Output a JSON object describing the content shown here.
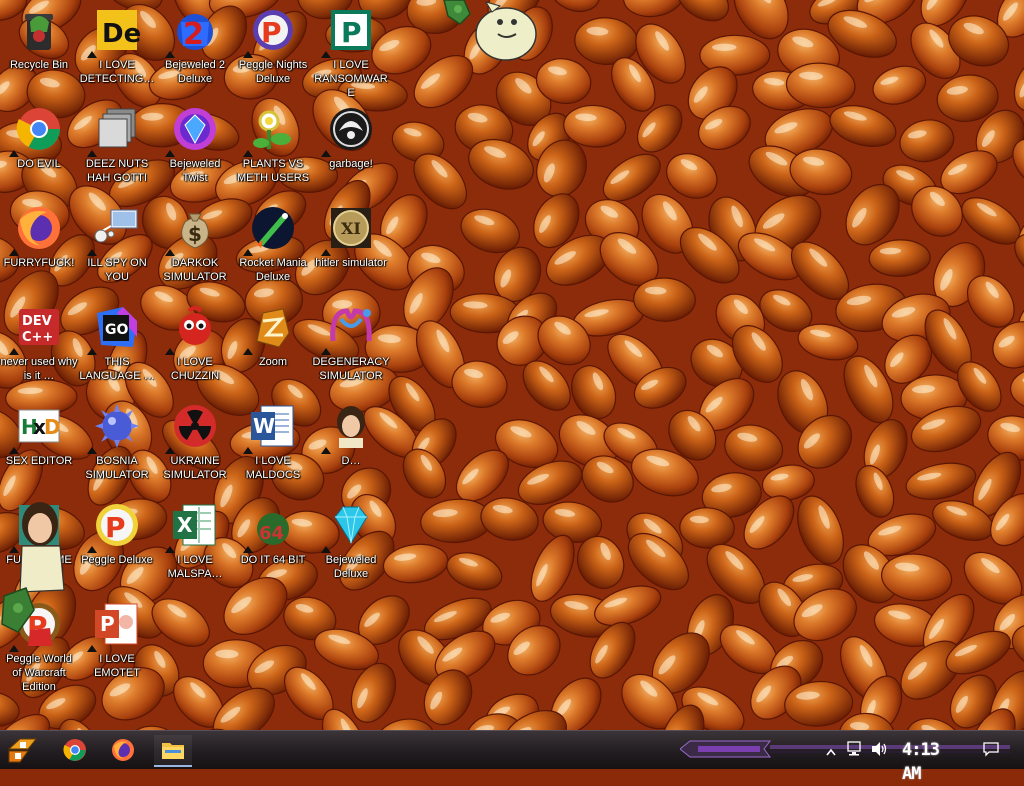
{
  "desktop": {
    "icons": [
      {
        "label": "Recycle Bin",
        "icon": "recycle-bin-icon"
      },
      {
        "label": "I LOVE DETECTING…",
        "icon": "detect-it-easy-icon"
      },
      {
        "label": "Bejeweled 2 Deluxe",
        "icon": "bejeweled-2-icon"
      },
      {
        "label": "Peggle Nights Deluxe",
        "icon": "peggle-nights-icon"
      },
      {
        "label": "I LOVE RANSOMWARE",
        "icon": "publisher-icon"
      },
      {
        "label": "DO EVIL",
        "icon": "chrome-icon"
      },
      {
        "label": "DEEZ NUTS HAH GOTTI",
        "icon": "stacked-windows-icon"
      },
      {
        "label": "Bejeweled Twist",
        "icon": "bejeweled-twist-icon"
      },
      {
        "label": "PLANTS VS METH USERS",
        "icon": "plants-vs-zombies-icon"
      },
      {
        "label": "garbage!",
        "icon": "garbage-emblem-icon"
      },
      {
        "label": "FURRYFUCK!",
        "icon": "firefox-icon"
      },
      {
        "label": "ILL SPY ON YOU",
        "icon": "network-spy-icon"
      },
      {
        "label": "DARKOK SIMULATOR",
        "icon": "money-bag-icon"
      },
      {
        "label": "Rocket Mania Deluxe",
        "icon": "rocket-mania-icon"
      },
      {
        "label": "hitler simulator",
        "icon": "medallion-icon"
      },
      {
        "label": "never used why is it …",
        "icon": "dev-cpp-icon"
      },
      {
        "label": "THIS LANGUAGE …",
        "icon": "goland-icon"
      },
      {
        "label": "I LOVE CHUZZIN",
        "icon": "chuzzle-icon"
      },
      {
        "label": "Zoom",
        "icon": "zuma-icon"
      },
      {
        "label": "DEGENERACY SIMULATOR",
        "icon": "mmd-icon"
      },
      {
        "label": "SEX EDITOR",
        "icon": "hxd-icon"
      },
      {
        "label": "BOSNIA SIMULATOR",
        "icon": "spiky-ball-icon"
      },
      {
        "label": "UKRAINE SIMULATOR",
        "icon": "radiation-icon"
      },
      {
        "label": "I LOVE MALDOCS",
        "icon": "word-icon"
      },
      {
        "label": "D…",
        "icon": "portrait-icon"
      },
      {
        "label": "FUCK SOME ELVES",
        "icon": "santa-icon"
      },
      {
        "label": "Peggle Deluxe",
        "icon": "peggle-icon"
      },
      {
        "label": "I LOVE MALSPA…",
        "icon": "excel-icon"
      },
      {
        "label": "DO IT 64 BIT",
        "icon": "sixty-four-bit-icon"
      },
      {
        "label": "Bejeweled Deluxe",
        "icon": "diamond-icon"
      },
      {
        "label": "Peggle World of Warcraft Edition",
        "icon": "peggle-wow-icon"
      },
      {
        "label": "I LOVE EMOTET",
        "icon": "powerpoint-icon"
      }
    ]
  },
  "taskbar": {
    "apps": [
      {
        "name": "chrome",
        "icon": "chrome-icon"
      },
      {
        "name": "firefox",
        "icon": "firefox-icon"
      },
      {
        "name": "file explorer",
        "icon": "folder-icon"
      }
    ],
    "clock": "4:13 AM"
  },
  "colors": {
    "bean_dark": "#8a2a08",
    "bean_mid": "#c55a14",
    "bean_light": "#e59040",
    "taskbar": "#221d20",
    "accent_purple": "#7b3fb0"
  }
}
